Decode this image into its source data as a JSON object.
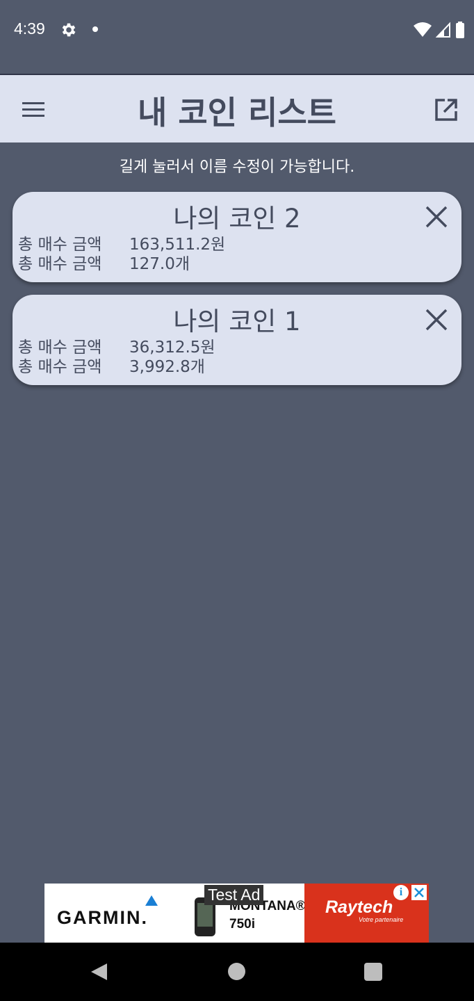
{
  "status_bar": {
    "time": "4:39",
    "icons": [
      "gear-icon",
      "notification-dot-icon",
      "wifi-icon",
      "signal-icon",
      "battery-icon"
    ]
  },
  "app_bar": {
    "title": "내 코인 리스트",
    "menu_icon": "hamburger-menu-icon",
    "export_icon": "open-external-icon",
    "background": "#dde2f0"
  },
  "hint": "길게 눌러서 이름 수정이 가능합니다.",
  "coins": [
    {
      "name": "나의 코인 2",
      "row1_label": "총 매수 금액",
      "row1_value": "163,511.2원",
      "row2_label": "총 매수 금액",
      "row2_value": "127.0개"
    },
    {
      "name": "나의 코인 1",
      "row1_label": "총 매수 금액",
      "row1_value": "36,312.5원",
      "row2_label": "총 매수 금액",
      "row2_value": "3,992.8개"
    }
  ],
  "ad": {
    "label": "Test Ad",
    "brand": "GARMIN.",
    "product_line1": "MONTANA®",
    "product_line2": "750i",
    "partner": "Raytech",
    "partner_sub": "Votre partenaire",
    "info_glyph": "i"
  },
  "colors": {
    "background": "#525a6c",
    "card": "#dde2f0",
    "text": "#444b5e"
  }
}
